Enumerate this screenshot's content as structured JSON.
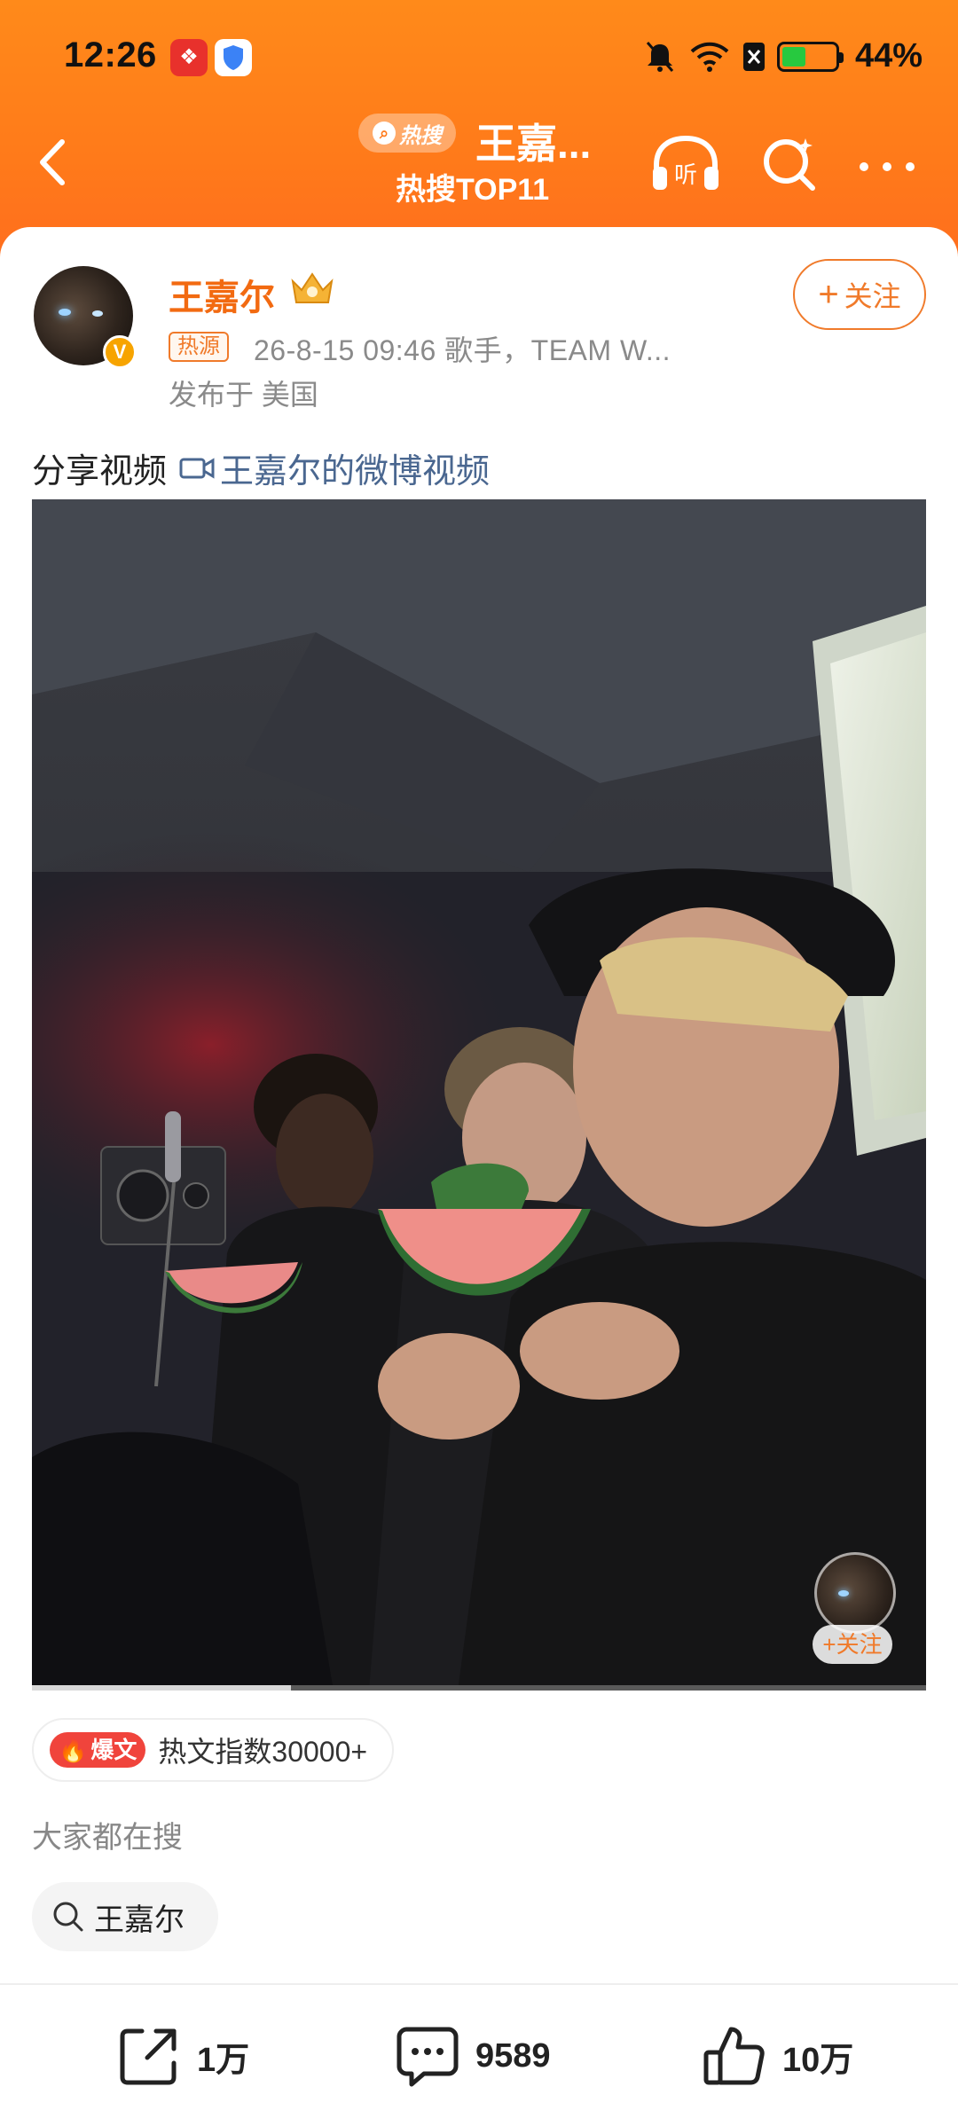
{
  "status_bar": {
    "time": "12:26",
    "battery_percent": "44%",
    "battery_level": 0.44
  },
  "nav": {
    "hot_badge": "热搜",
    "title": "王嘉...",
    "subtitle": "热搜TOP11"
  },
  "post": {
    "user_name": "王嘉尔",
    "source_tag": "热源",
    "meta": "26-8-15 09:46   歌手，TEAM W...",
    "location": "发布于 美国",
    "follow_label": "关注",
    "text_prefix": "分享视频",
    "video_link": "王嘉尔的微博视频"
  },
  "video": {
    "follow_label": "+关注",
    "progress": 0.29
  },
  "hot_article": {
    "tag": "爆文",
    "text": "热文指数30000+"
  },
  "search_section": {
    "heading": "大家都在搜",
    "query": "王嘉尔"
  },
  "actions": {
    "share_count": "1万",
    "comment_count": "9589",
    "like_count": "10万"
  },
  "colors": {
    "brand_orange": "#ff7a1a",
    "accent_orange": "#f26a11",
    "link_blue": "#4a6790",
    "hot_red": "#f0443c"
  },
  "icons": {
    "back": "chevron-left-icon",
    "listen": "headphones-icon",
    "search": "search-icon",
    "more": "more-dots-icon",
    "share": "share-icon",
    "comment": "comment-icon",
    "like": "thumbs-up-icon"
  }
}
